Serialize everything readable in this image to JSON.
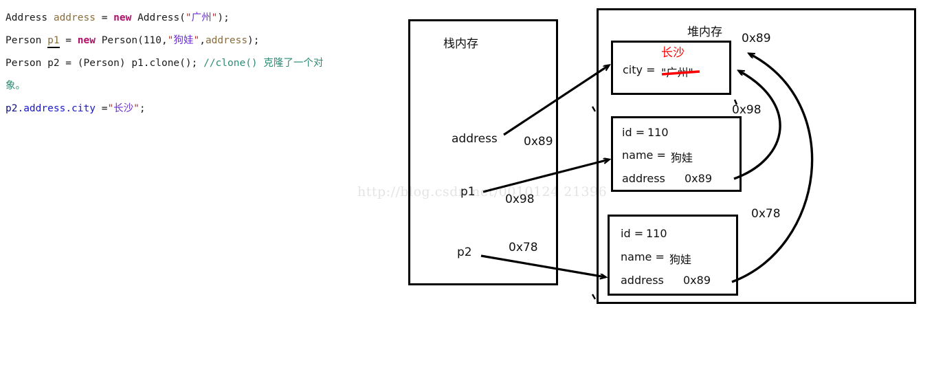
{
  "code": {
    "lines": [
      [
        {
          "t": "Address ",
          "c": "t-plain"
        },
        {
          "t": "address ",
          "c": "t-var"
        },
        {
          "t": "= ",
          "c": "t-plain"
        },
        {
          "t": "new ",
          "c": "t-kw"
        },
        {
          "t": "Address(",
          "c": "t-plain"
        },
        {
          "t": "\"",
          "c": "t-quote"
        },
        {
          "t": "广州",
          "c": "t-str"
        },
        {
          "t": "\"",
          "c": "t-quote"
        },
        {
          "t": ");",
          "c": "t-plain"
        }
      ],
      [
        {
          "t": "Person ",
          "c": "t-plain"
        },
        {
          "t": "p1",
          "c": "t-var u-underline"
        },
        {
          "t": " = ",
          "c": "t-plain"
        },
        {
          "t": "new ",
          "c": "t-kw"
        },
        {
          "t": "Person(",
          "c": "t-plain"
        },
        {
          "t": "110,",
          "c": "t-num"
        },
        {
          "t": "\"",
          "c": "t-quote"
        },
        {
          "t": "狗娃",
          "c": "t-str"
        },
        {
          "t": "\"",
          "c": "t-quote"
        },
        {
          "t": ",",
          "c": "t-plain"
        },
        {
          "t": "address",
          "c": "t-var"
        },
        {
          "t": ");",
          "c": "t-plain"
        }
      ],
      [
        {
          "t": "Person p2 = (Person) p1.clone(); ",
          "c": "t-plain"
        },
        {
          "t": "//clone() 克隆了一个对",
          "c": "t-comment"
        }
      ],
      [
        {
          "t": "象。",
          "c": "t-comment"
        }
      ],
      [
        {
          "t": "p2",
          "c": "t-obj"
        },
        {
          "t": ".address",
          "c": "t-field"
        },
        {
          "t": ".city",
          "c": "t-field"
        },
        {
          "t": " =",
          "c": "t-plain"
        },
        {
          "t": "\"",
          "c": "t-quote"
        },
        {
          "t": "长沙",
          "c": "t-str"
        },
        {
          "t": "\"",
          "c": "t-quote"
        },
        {
          "t": ";",
          "c": "t-plain"
        }
      ]
    ]
  },
  "watermark": {
    "text": "http://blog.csdn.net/0010124 21396"
  },
  "stack": {
    "title": "栈内存",
    "entries": [
      {
        "name": "address",
        "value": "0x89"
      },
      {
        "name": "p1",
        "value": "0x98"
      },
      {
        "name": "p2",
        "value": "0x78"
      }
    ]
  },
  "heap": {
    "title": "堆内存",
    "objects": [
      {
        "address": "0x89",
        "type": "Address",
        "annotation": "长沙",
        "fields": [
          {
            "label": "city = ",
            "value": "\"广州\"",
            "struck": true
          }
        ]
      },
      {
        "address": "0x98",
        "type": "Person",
        "fields": [
          {
            "label": "id = ",
            "value": "110"
          },
          {
            "label": "name = ",
            "value": "狗娃"
          },
          {
            "label": "address",
            "value": "0x89"
          }
        ]
      },
      {
        "address": "0x78",
        "type": "Person",
        "fields": [
          {
            "label": "id = ",
            "value": "110"
          },
          {
            "label": "name = ",
            "value": "狗娃"
          },
          {
            "label": "address",
            "value": "0x89"
          }
        ]
      }
    ]
  },
  "colors": {
    "stroke": "#000000",
    "annotation_red": "#ff0000",
    "string_purple": "#6a2fd0",
    "keyword_magenta": "#b0106a",
    "comment_teal": "#2e8b74",
    "variable_tan": "#8a6d3b",
    "field_blue": "#1818c8",
    "watermark_gray": "#e4e4e4"
  }
}
